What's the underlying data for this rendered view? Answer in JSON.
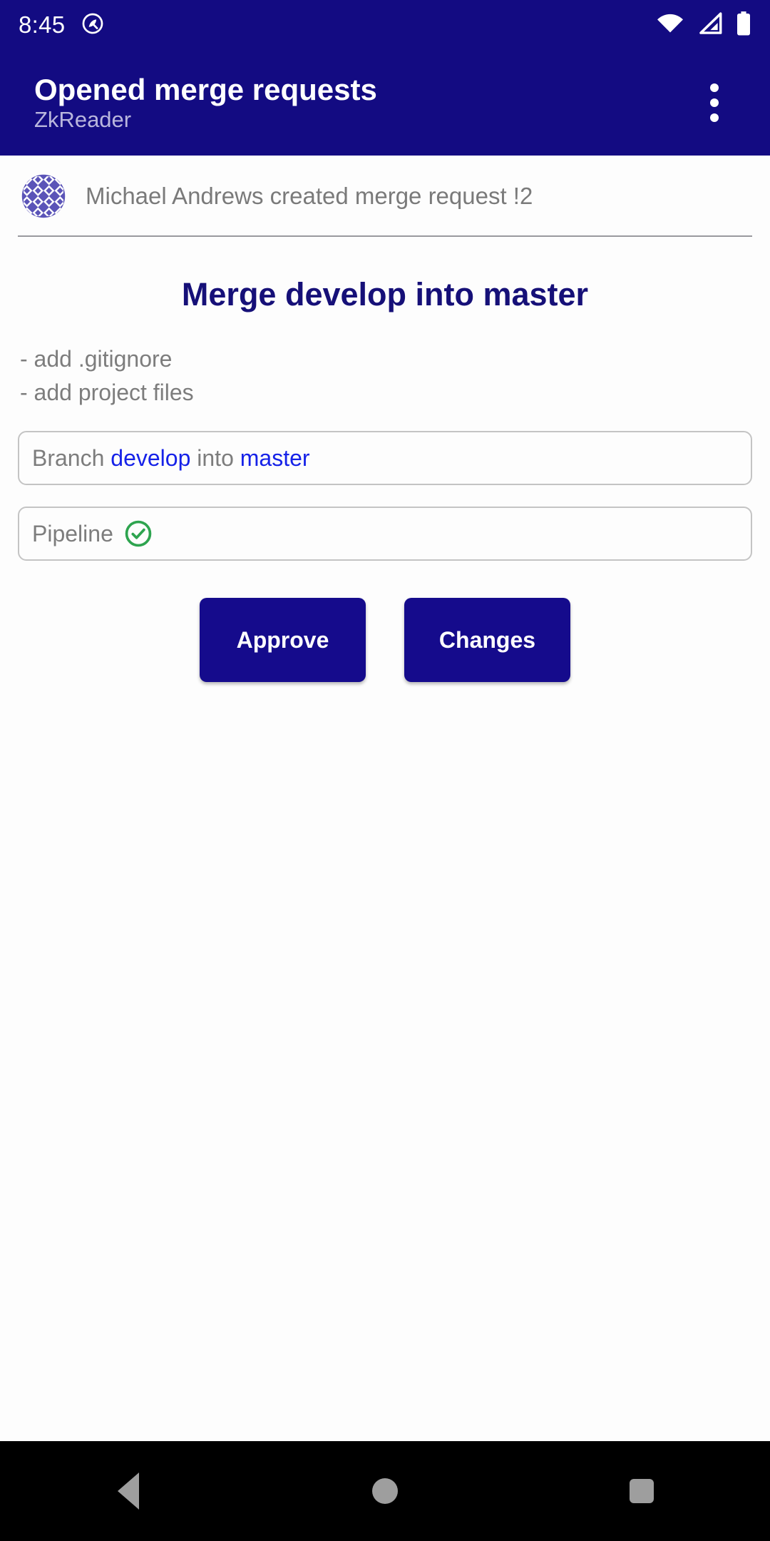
{
  "status_bar": {
    "clock": "8:45",
    "icons": [
      "android-q-icon",
      "wifi-icon",
      "cellular-signal-icon",
      "battery-icon"
    ]
  },
  "app_bar": {
    "title": "Opened merge requests",
    "subtitle": "ZkReader",
    "overflow_menu": "overflow-menu",
    "background_color": "#130b82"
  },
  "merge_request": {
    "author_line": "Michael Andrews created merge request !2",
    "avatar": "identicon-avatar",
    "title": "Merge develop into master",
    "description": "- add .gitignore\n- add project files",
    "branch": {
      "prefix": "Branch",
      "source": "develop",
      "middle": "into",
      "target": "master",
      "link_color": "#1622e8"
    },
    "pipeline": {
      "label": "Pipeline",
      "status_icon": "check-circle-icon",
      "status_color": "#2ea44f"
    },
    "actions": {
      "approve_label": "Approve",
      "changes_label": "Changes",
      "button_color": "#150b8c"
    }
  },
  "navigation_bar": {
    "back": "back-button",
    "home": "home-button",
    "recents": "recents-button"
  }
}
